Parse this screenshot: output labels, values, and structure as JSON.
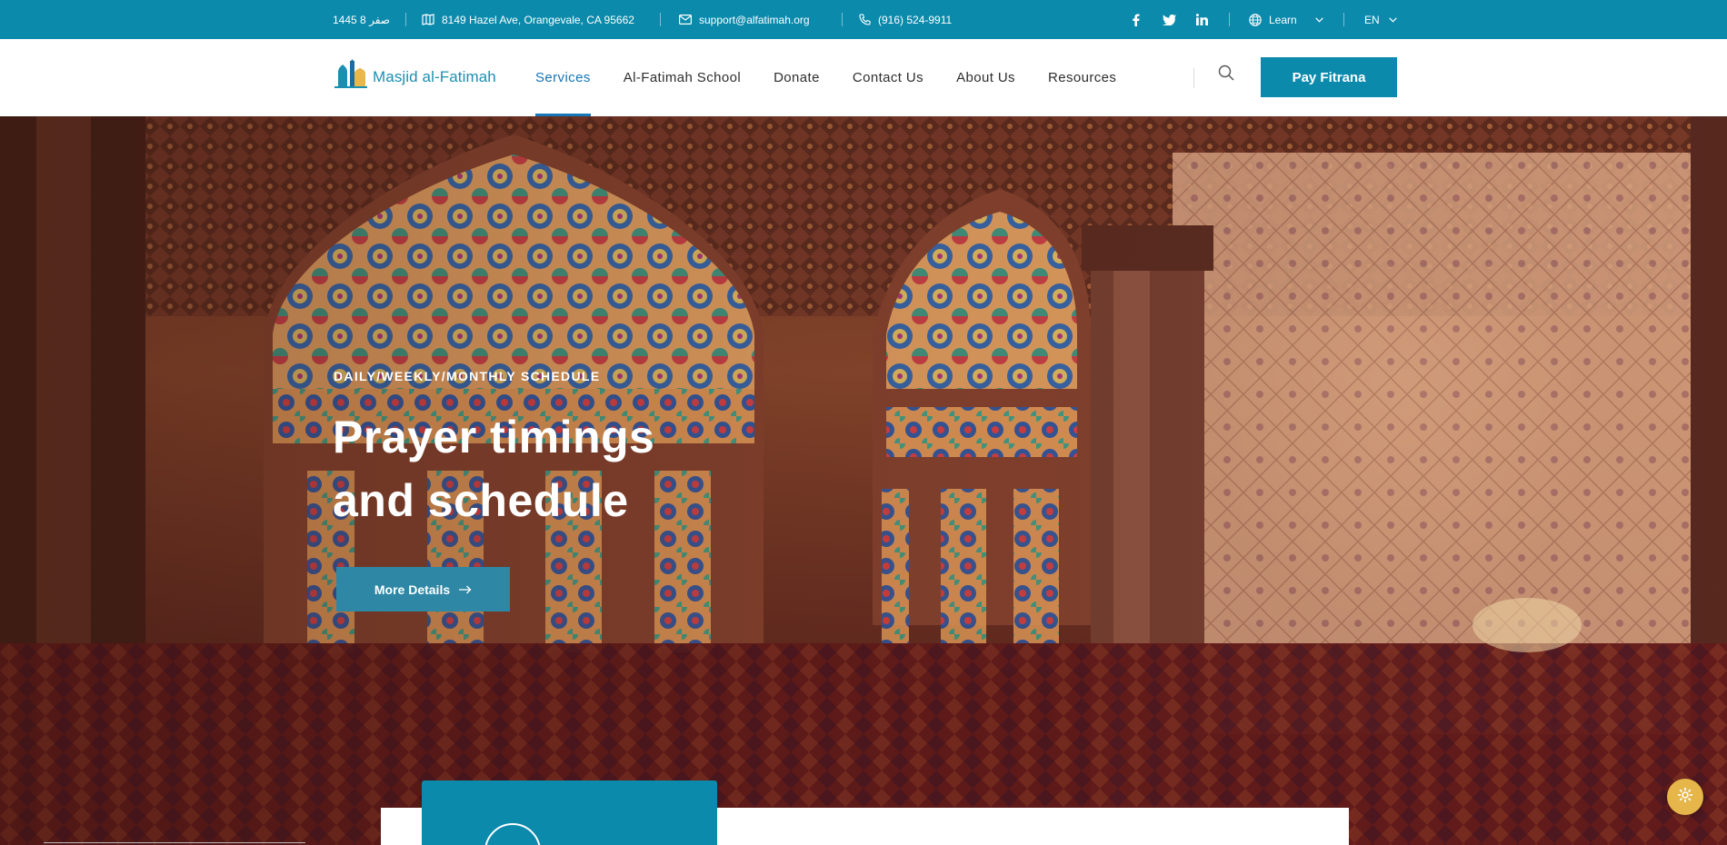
{
  "topbar": {
    "hijri_date": "صفر 8 1445",
    "address": "8149 Hazel Ave, Orangevale, CA 95662",
    "email": "support@alfatimah.org",
    "phone": "(916) 524-9911",
    "social": [
      "facebook-icon",
      "twitter-icon",
      "linkedin-icon"
    ],
    "learn_label": "Learn",
    "language": "EN"
  },
  "header": {
    "logo_text": "Masjid al-Fatimah",
    "nav": [
      {
        "label": "Services",
        "active": true
      },
      {
        "label": "Al-Fatimah School",
        "active": false
      },
      {
        "label": "Donate",
        "active": false
      },
      {
        "label": "Contact Us",
        "active": false
      },
      {
        "label": "About Us",
        "active": false
      },
      {
        "label": "Resources",
        "active": false
      }
    ],
    "cta_label": "Pay Fitrana"
  },
  "hero": {
    "eyebrow": "DAILY/WEEKLY/MONTHLY SCHEDULE",
    "title_line1": "Prayer timings",
    "title_line2": "and schedule",
    "button_label": "More Details"
  },
  "colors": {
    "brand": "#0b8aac",
    "nav_active": "#1576b8",
    "hero_button": "#2e87a5",
    "settings": "#e6b64a"
  }
}
